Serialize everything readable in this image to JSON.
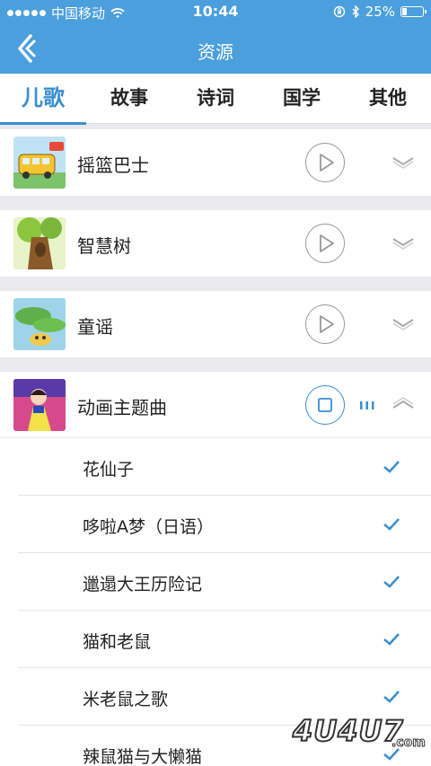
{
  "status_bar": {
    "carrier": "中国移动",
    "time": "10:44",
    "battery": "25%",
    "battery_level": 0.25,
    "signal_icon": "signal-dots-icon",
    "wifi_icon": "wifi-icon",
    "bluetooth_icon": "bluetooth-icon",
    "lock_icon": "orientation-lock-icon"
  },
  "header": {
    "title": "资源",
    "back_icon": "back-logo-icon",
    "color": "#4a9fdc"
  },
  "tabs": [
    {
      "label": "儿歌",
      "active": true
    },
    {
      "label": "故事",
      "active": false
    },
    {
      "label": "诗词",
      "active": false
    },
    {
      "label": "国学",
      "active": false
    },
    {
      "label": "其他",
      "active": false
    }
  ],
  "categories": [
    {
      "label": "摇篮巴士",
      "state": "collapsed",
      "control": "play-icon"
    },
    {
      "label": "智慧树",
      "state": "collapsed",
      "control": "play-icon"
    },
    {
      "label": "童谣",
      "state": "collapsed",
      "control": "play-icon"
    },
    {
      "label": "动画主题曲",
      "state": "expanded",
      "control": "stop-icon"
    }
  ],
  "tracks": [
    {
      "title": "花仙子",
      "checked": true
    },
    {
      "title": "哆啦A梦（日语）",
      "checked": true
    },
    {
      "title": "邋遢大王历险记",
      "checked": true
    },
    {
      "title": "猫和老鼠",
      "checked": true
    },
    {
      "title": "米老鼠之歌",
      "checked": true
    },
    {
      "title": "辣鼠猫与大懒猫",
      "checked": true
    }
  ],
  "watermark": {
    "text": "4U4U7",
    "suffix": ".com"
  },
  "colors": {
    "accent": "#3a8fd2",
    "header": "#4a9fdc"
  }
}
